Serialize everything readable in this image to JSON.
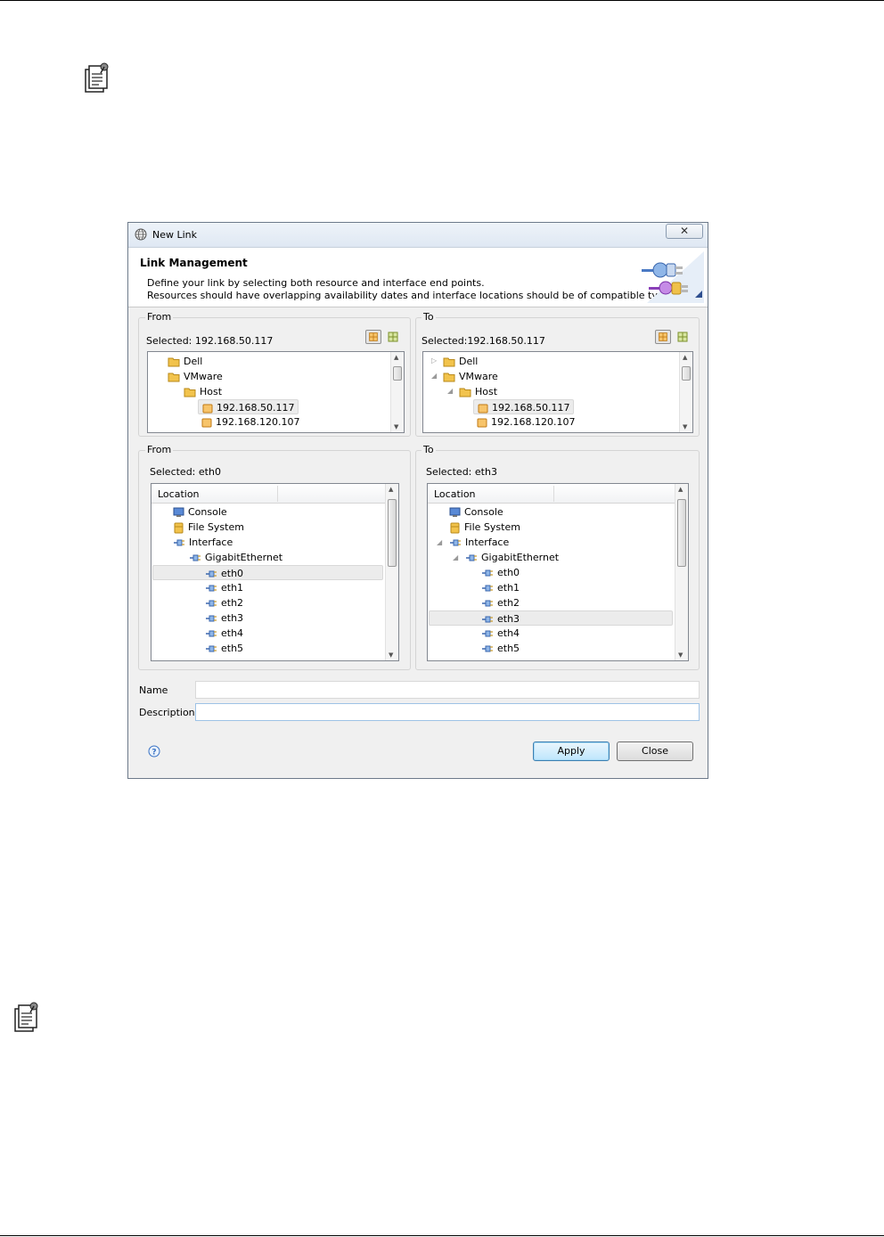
{
  "dialog": {
    "title": "New Link",
    "close_glyph": "✕",
    "banner": {
      "heading": "Link Management",
      "line1": "Define your link by selecting both resource and interface end points.",
      "line2": "Resources should have overlapping availability dates and interface locations should be of compatible types."
    },
    "resources": {
      "from": {
        "group_label": "From",
        "selected": "Selected: 192.168.50.117",
        "tree": [
          "Dell",
          "VMware",
          "Host",
          "192.168.50.117",
          "192.168.120.107"
        ]
      },
      "to": {
        "group_label": "To",
        "selected": "Selected:192.168.50.117",
        "tree": [
          "Dell",
          "VMware",
          "Host",
          "192.168.50.117",
          "192.168.120.107"
        ]
      }
    },
    "interfaces": {
      "from": {
        "group_label": "From",
        "selected": "Selected: eth0",
        "column_header": "Location",
        "tree": [
          "Console",
          "File System",
          "Interface",
          "GigabitEthernet",
          "eth0",
          "eth1",
          "eth2",
          "eth3",
          "eth4",
          "eth5"
        ]
      },
      "to": {
        "group_label": "To",
        "selected": "Selected: eth3",
        "column_header": "Location",
        "tree": [
          "Console",
          "File System",
          "Interface",
          "GigabitEthernet",
          "eth0",
          "eth1",
          "eth2",
          "eth3",
          "eth4",
          "eth5"
        ]
      }
    },
    "form": {
      "name_label": "Name",
      "name_value": "",
      "description_label": "Description",
      "description_value": ""
    },
    "buttons": {
      "apply": "Apply",
      "close": "Close"
    },
    "icons": {
      "note": "note-icon",
      "help": "help-icon",
      "folder": "folder-icon",
      "host": "host-icon",
      "interface": "interface-icon"
    },
    "colors": {
      "default_button": "#bee6fd",
      "focus_border": "#9ec3e6",
      "folder": "#f2c34c"
    }
  }
}
